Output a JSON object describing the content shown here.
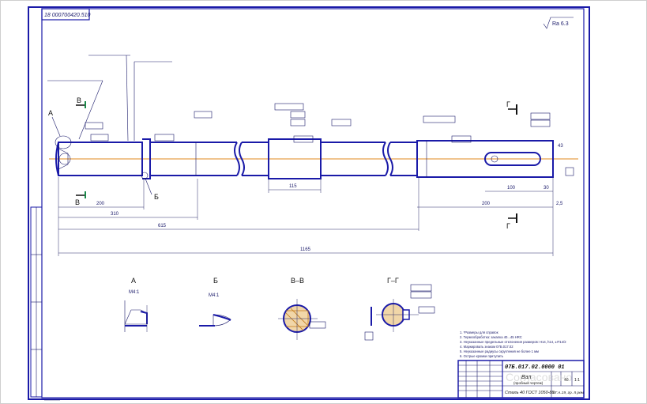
{
  "sheet": {
    "doc_code_rotated": "18 000700420.510",
    "roughness_general": "Ra 6.3",
    "title_code": "07Б.017.02.0000 01",
    "part_name": "Вал",
    "part_subtitle": "(пробный чертеж)",
    "material": "Сталь 40 ГОСТ 1050-88",
    "material_extra": "6Г.А.19, гр. II рем",
    "scale": "1:1",
    "sheet_mass": "40",
    "sheet_number": "1"
  },
  "views": {
    "label_A": "А",
    "label_B": "Б",
    "label_BB": "В–В",
    "label_GG": "Г–Г",
    "cut_B": "В",
    "cut_G": "Г",
    "scale_A": "М4:1",
    "scale_B": "М4:1"
  },
  "shaft_labels": {
    "leader_A": "А",
    "leader_B": "Б",
    "section_B_top": "В",
    "section_B_bottom": "В",
    "section_G_top": "Г",
    "section_G_bottom": "Г"
  },
  "dimensions": {
    "overall_length": "1165",
    "len_a": "615",
    "len_b": "310",
    "len_c": "200",
    "len_d": "43",
    "len_e": "115",
    "len_f": "200",
    "len_g": "100",
    "len_h": "30",
    "len_i": "2,5"
  },
  "tech_requirements": {
    "lines": [
      "1. *Размеры для справок",
      "2. Термообработка: закалка 40...45 HRC",
      "3. Неуказанные предельные отклонения размеров: H14, h14, ±IT14/2",
      "4. Маркировать знаком 07Б.017.02",
      "5. Неуказанные радиусы скругления не более 1 мм",
      "6. Острые кромки притупить"
    ]
  },
  "watermark": "Согласовано",
  "colors": {
    "frame": "#1a1aa8",
    "axis": "#e08a1e",
    "hatch": "#c27a1a",
    "marker_green": "#1a8a4a"
  }
}
